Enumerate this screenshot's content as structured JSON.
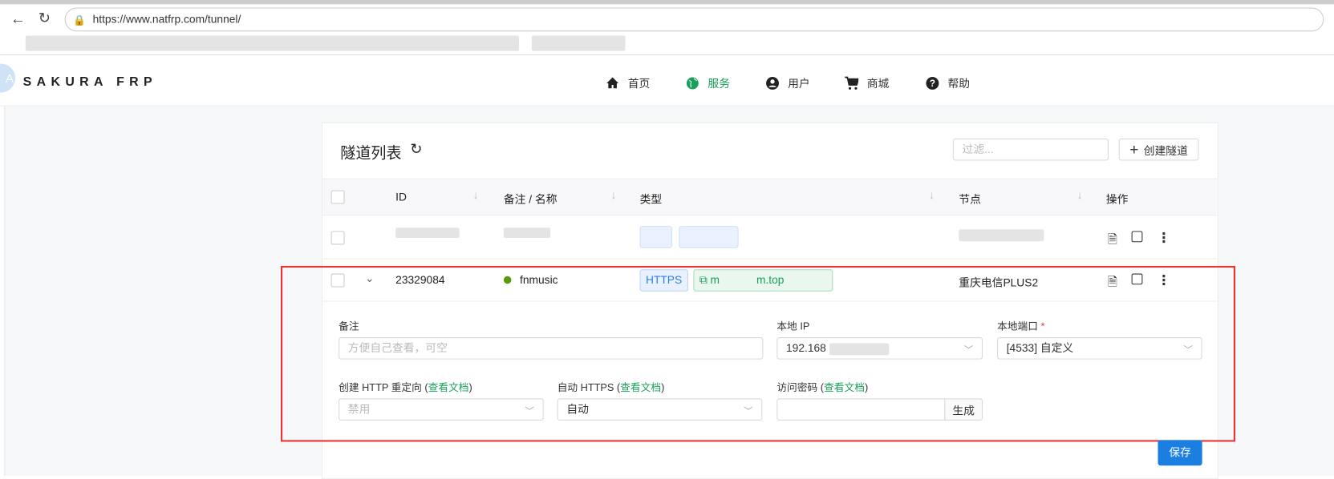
{
  "browser": {
    "url": "https://www.natfrp.com/tunnel/"
  },
  "header": {
    "logo": "SAKURA FRP",
    "avatar": "A",
    "nav": [
      {
        "label": "首页",
        "icon": "home-icon"
      },
      {
        "label": "服务",
        "icon": "globe-icon",
        "active": true
      },
      {
        "label": "用户",
        "icon": "user-icon"
      },
      {
        "label": "商城",
        "icon": "cart-icon"
      },
      {
        "label": "帮助",
        "icon": "help-icon"
      }
    ]
  },
  "panel": {
    "title": "隧道列表",
    "filter_placeholder": "过滤...",
    "create_label": "创建隧道"
  },
  "table": {
    "columns": [
      "ID",
      "备注 / 名称",
      "类型",
      "节点",
      "操作"
    ],
    "rows": [
      {
        "id": "",
        "name": "",
        "type": "",
        "node": ""
      },
      {
        "id": "23329084",
        "name": "fnmusic",
        "type": "HTTPS",
        "domain": "m            m.top",
        "node": "重庆电信PLUS2",
        "expanded": true
      }
    ]
  },
  "detail": {
    "note_label": "备注",
    "note_placeholder": "方便自己查看，可空",
    "ip_label": "本地 IP",
    "ip_value": "192.168",
    "port_label": "本地端口",
    "port_required": "*",
    "port_value": "[4533] 自定义",
    "redirect_label": "创建 HTTP 重定向 (",
    "redirect_doc": "查看文档",
    "redirect_value": "禁用",
    "autohttps_label": "自动 HTTPS (",
    "autohttps_doc": "查看文档",
    "autohttps_value": "自动",
    "password_label": "访问密码 (",
    "password_doc": "查看文档",
    "close_paren": ")",
    "generate": "生成",
    "save": "保存"
  },
  "colors": {
    "accent": "#18a058",
    "primary": "#1a7fe0",
    "highlight": "#ee3333"
  }
}
